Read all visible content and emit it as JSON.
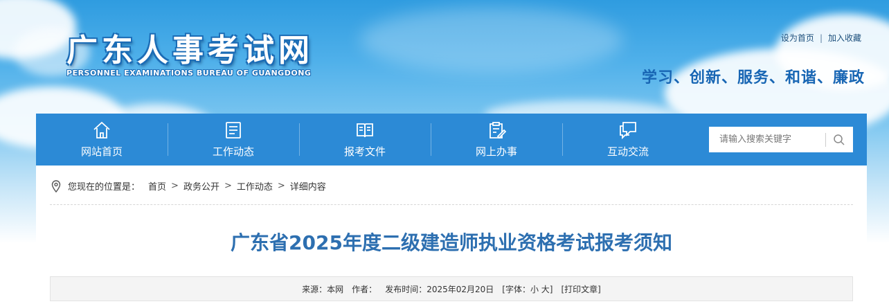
{
  "header": {
    "logo_cn": "广东人事考试网",
    "logo_en": "PERSONNEL EXAMINATIONS BUREAU OF GUANGDONG",
    "links": {
      "home": "设为首页",
      "separator": "|",
      "favorite": "加入收藏"
    },
    "slogan": "学习、创新、服务、和谐、廉政"
  },
  "nav": {
    "items": [
      {
        "label": "网站首页",
        "icon": "home-icon"
      },
      {
        "label": "工作动态",
        "icon": "newspaper-icon"
      },
      {
        "label": "报考文件",
        "icon": "book-icon"
      },
      {
        "label": "网上办事",
        "icon": "clipboard-pen-icon"
      },
      {
        "label": "互动交流",
        "icon": "chat-bubble-icon"
      }
    ],
    "search": {
      "placeholder": "请输入搜索关键字",
      "icon": "search-icon"
    }
  },
  "breadcrumb": {
    "lead": "您现在的位置是：",
    "items": [
      "首页",
      "政务公开",
      "工作动态",
      "详细内容"
    ],
    "separator": ">"
  },
  "article": {
    "title": "广东省2025年度二级建造师执业资格考试报考须知",
    "meta": {
      "source": "来源：本网",
      "author": "作者：",
      "date": "发布时间：2025年02月20日",
      "font_size": "[字体：小 大]",
      "print": "[打印文章]"
    }
  },
  "colors": {
    "nav_bg": "#2c8ad6",
    "title": "#2d6fb0",
    "slogan": "#1866b4"
  }
}
